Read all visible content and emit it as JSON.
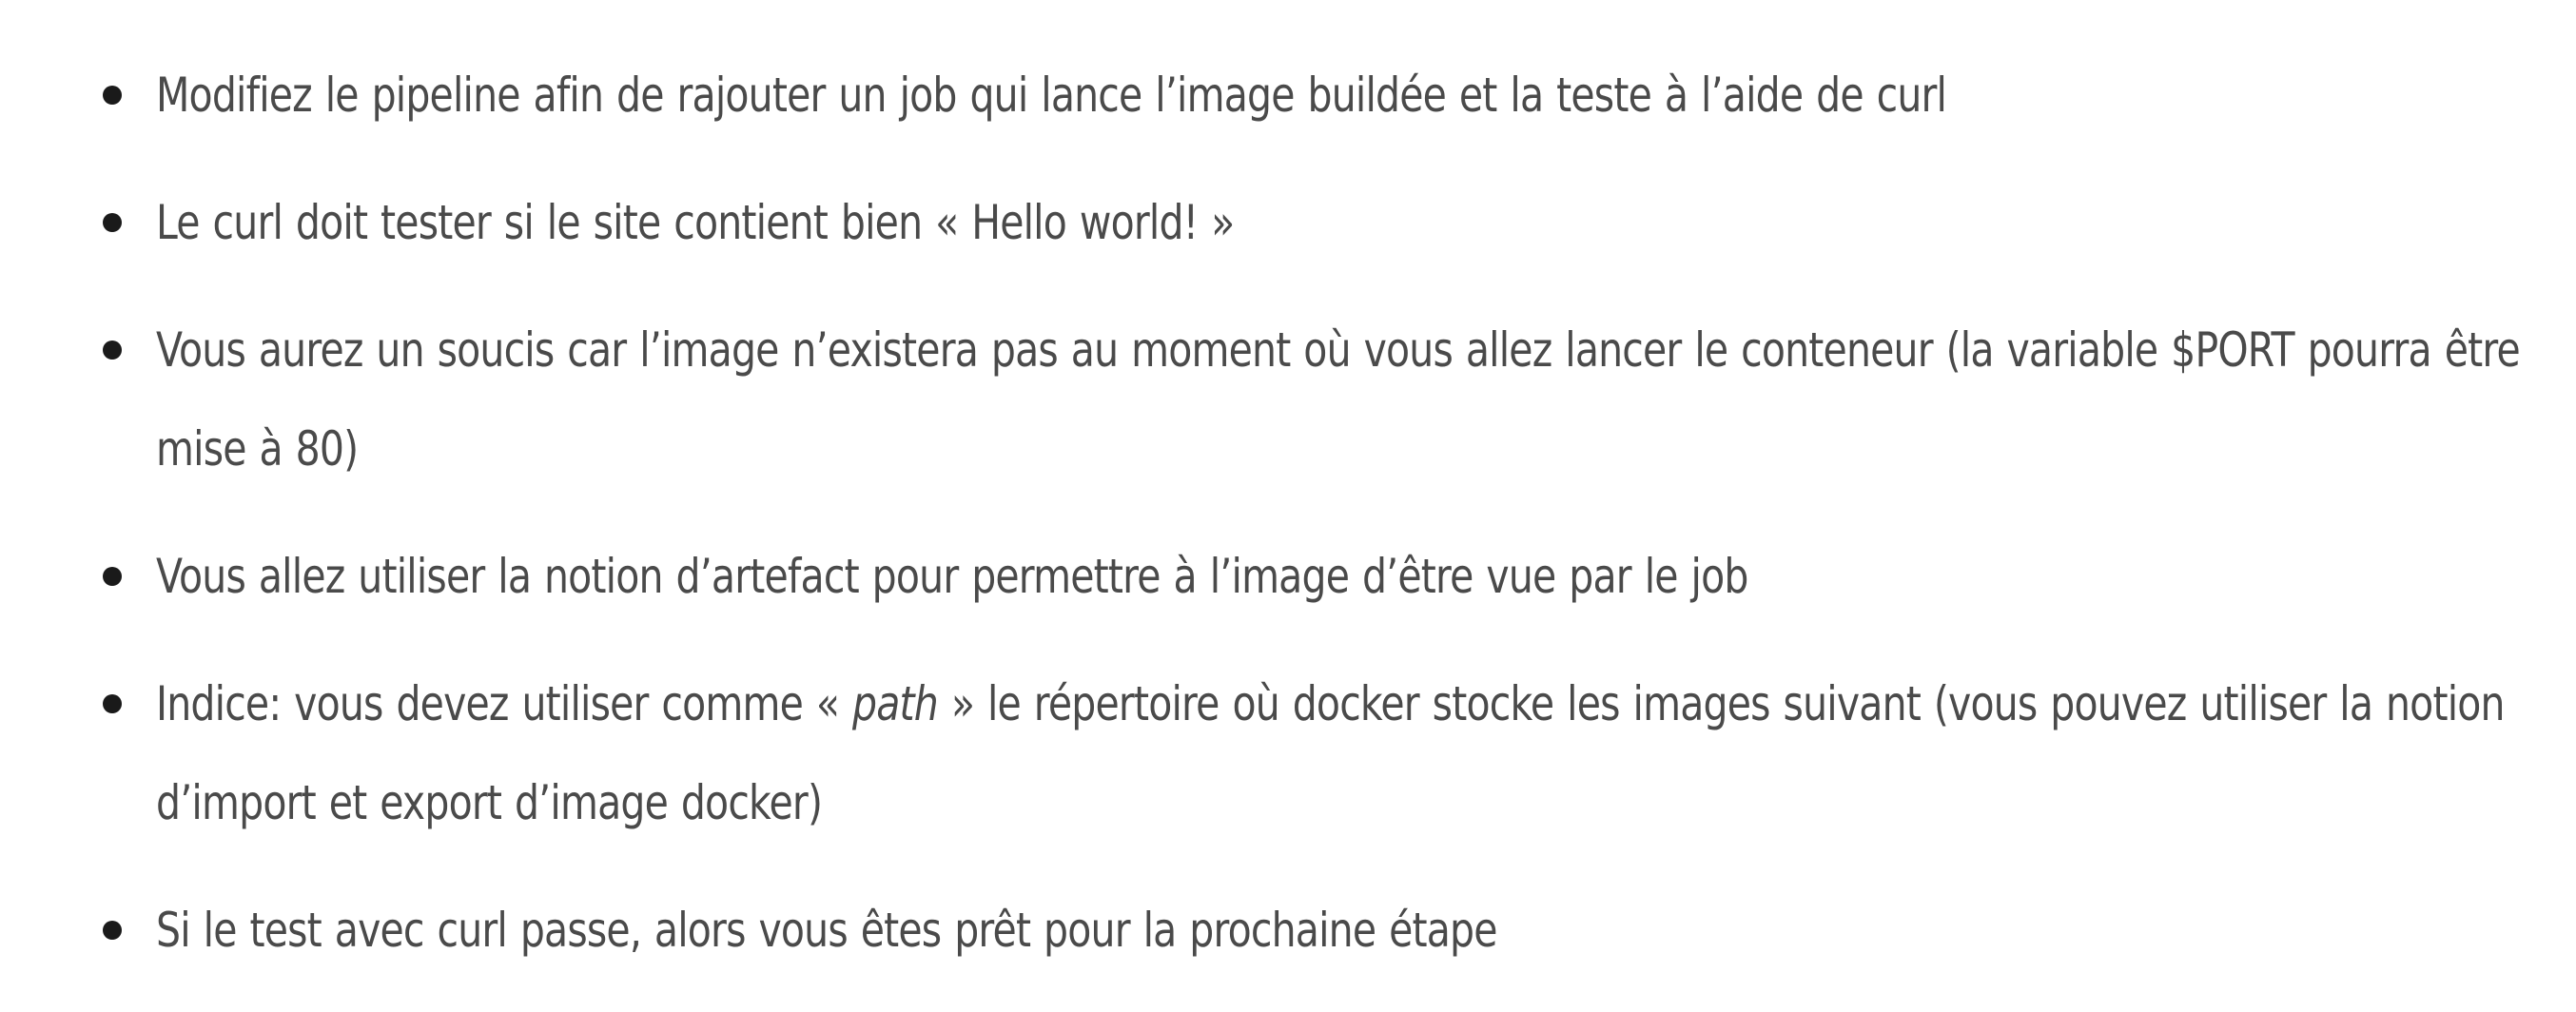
{
  "items": [
    {
      "text": "Modifiez le pipeline afin de rajouter un job qui lance l’image buildée et la teste à l’aide de curl"
    },
    {
      "text": "Le curl doit tester si le site contient bien «  Hello world! »"
    },
    {
      "text": "Vous aurez un soucis car l’image n’existera pas au moment où vous allez lancer le conteneur (la variable $PORT pourra être mise à 80)"
    },
    {
      "text": "Vous allez utiliser la notion d’artefact pour permettre à l’image d’être vue par le job"
    },
    {
      "prefix": "Indice: vous devez utiliser comme « ",
      "emphasis": "path",
      "suffix": " » le répertoire où docker stocke les images suivant (vous pouvez utiliser la notion d’import et export d’image docker)"
    },
    {
      "text": "Si le test avec curl passe, alors vous êtes prêt pour la prochaine étape"
    }
  ]
}
